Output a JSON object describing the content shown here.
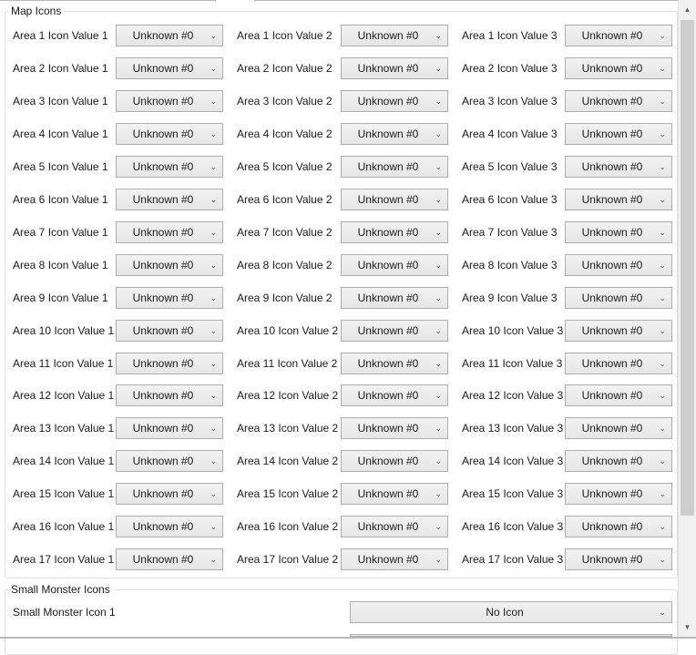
{
  "map_icons": {
    "title": "Map Icons",
    "rows": [
      {
        "labels": [
          "Area 1 Icon Value 1",
          "Area 1 Icon Value 2",
          "Area 1 Icon Value 3"
        ],
        "values": [
          "Unknown #0",
          "Unknown #0",
          "Unknown #0"
        ]
      },
      {
        "labels": [
          "Area 2 Icon Value 1",
          "Area 2 Icon Value 2",
          "Area 2 Icon Value 3"
        ],
        "values": [
          "Unknown #0",
          "Unknown #0",
          "Unknown #0"
        ]
      },
      {
        "labels": [
          "Area 3 Icon Value 1",
          "Area 3 Icon Value 2",
          "Area 3 Icon Value 3"
        ],
        "values": [
          "Unknown #0",
          "Unknown #0",
          "Unknown #0"
        ]
      },
      {
        "labels": [
          "Area 4 Icon Value 1",
          "Area 4 Icon Value 2",
          "Area 4 Icon Value 3"
        ],
        "values": [
          "Unknown #0",
          "Unknown #0",
          "Unknown #0"
        ]
      },
      {
        "labels": [
          "Area 5 Icon Value 1",
          "Area 5 Icon Value 2",
          "Area 5 Icon Value 3"
        ],
        "values": [
          "Unknown #0",
          "Unknown #0",
          "Unknown #0"
        ]
      },
      {
        "labels": [
          "Area 6 Icon Value 1",
          "Area 6 Icon Value 2",
          "Area 6 Icon Value 3"
        ],
        "values": [
          "Unknown #0",
          "Unknown #0",
          "Unknown #0"
        ]
      },
      {
        "labels": [
          "Area 7 Icon Value 1",
          "Area 7 Icon Value 2",
          "Area 7 Icon Value 3"
        ],
        "values": [
          "Unknown #0",
          "Unknown #0",
          "Unknown #0"
        ]
      },
      {
        "labels": [
          "Area 8 Icon Value 1",
          "Area 8 Icon Value 2",
          "Area 8 Icon Value 3"
        ],
        "values": [
          "Unknown #0",
          "Unknown #0",
          "Unknown #0"
        ]
      },
      {
        "labels": [
          "Area 9 Icon Value 1",
          "Area 9 Icon Value 2",
          "Area 9 Icon Value 3"
        ],
        "values": [
          "Unknown #0",
          "Unknown #0",
          "Unknown #0"
        ]
      },
      {
        "labels": [
          "Area 10 Icon Value 1",
          "Area 10 Icon Value 2",
          "Area 10 Icon Value 3"
        ],
        "values": [
          "Unknown #0",
          "Unknown #0",
          "Unknown #0"
        ]
      },
      {
        "labels": [
          "Area 11 Icon Value 1",
          "Area 11 Icon Value 2",
          "Area 11 Icon Value 3"
        ],
        "values": [
          "Unknown #0",
          "Unknown #0",
          "Unknown #0"
        ]
      },
      {
        "labels": [
          "Area 12 Icon Value 1",
          "Area 12 Icon Value 2",
          "Area 12 Icon Value 3"
        ],
        "values": [
          "Unknown #0",
          "Unknown #0",
          "Unknown #0"
        ]
      },
      {
        "labels": [
          "Area 13 Icon Value 1",
          "Area 13 Icon Value 2",
          "Area 13 Icon Value 3"
        ],
        "values": [
          "Unknown #0",
          "Unknown #0",
          "Unknown #0"
        ]
      },
      {
        "labels": [
          "Area 14 Icon Value 1",
          "Area 14 Icon Value 2",
          "Area 14 Icon Value 3"
        ],
        "values": [
          "Unknown #0",
          "Unknown #0",
          "Unknown #0"
        ]
      },
      {
        "labels": [
          "Area 15 Icon Value 1",
          "Area 15 Icon Value 2",
          "Area 15 Icon Value 3"
        ],
        "values": [
          "Unknown #0",
          "Unknown #0",
          "Unknown #0"
        ]
      },
      {
        "labels": [
          "Area 16 Icon Value 1",
          "Area 16 Icon Value 2",
          "Area 16 Icon Value 3"
        ],
        "values": [
          "Unknown #0",
          "Unknown #0",
          "Unknown #0"
        ]
      },
      {
        "labels": [
          "Area 17 Icon Value 1",
          "Area 17 Icon Value 2",
          "Area 17 Icon Value 3"
        ],
        "values": [
          "Unknown #0",
          "Unknown #0",
          "Unknown #0"
        ]
      }
    ]
  },
  "small_monster_icons": {
    "title": "Small Monster Icons",
    "rows": [
      {
        "label": "Small Monster Icon 1",
        "value": "No Icon"
      }
    ]
  },
  "icons": {
    "dropdown_arrow": "chevron-down-icon",
    "scroll_up": "scroll-up-arrow-icon",
    "scroll_down": "scroll-down-arrow-icon"
  }
}
